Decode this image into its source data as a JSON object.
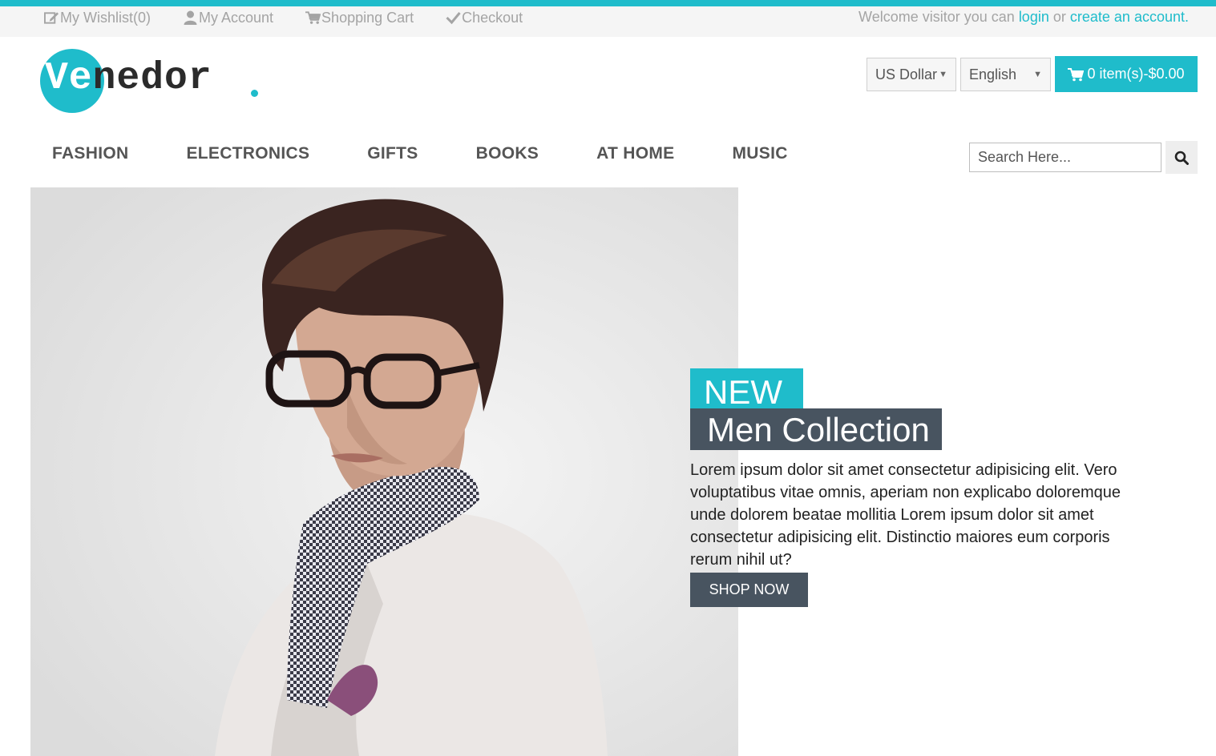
{
  "colors": {
    "accent": "#1fbccb",
    "dark": "#485460",
    "topbar_bg": "#f5f5f5",
    "muted_text": "#a4a4a4"
  },
  "topbar": {
    "links": [
      {
        "label": "My Wishlist(0)",
        "icon": "edit-icon"
      },
      {
        "label": "My Account",
        "icon": "user-icon"
      },
      {
        "label": "Shopping Cart",
        "icon": "cart-icon"
      },
      {
        "label": "Checkout",
        "icon": "check-icon"
      }
    ],
    "welcome_prefix": "Welcome visitor you can",
    "login_label": "login",
    "or_label": "or",
    "create_account_label": "create an account."
  },
  "logo": {
    "part1": "Ve",
    "part2": "nedor"
  },
  "header": {
    "currency": "US Dollar",
    "language": "English",
    "cart_label": "0 item(s)-$0.00"
  },
  "nav": {
    "items": [
      "FASHION",
      "ELECTRONICS",
      "GIFTS",
      "BOOKS",
      "AT HOME",
      "MUSIC"
    ]
  },
  "search": {
    "placeholder": "Search Here..."
  },
  "hero": {
    "badge": "NEW",
    "title": "Men Collection",
    "description": "Lorem ipsum dolor sit amet consectetur adipisicing elit. Vero voluptatibus vitae omnis, aperiam non explicabo doloremque unde dolorem beatae mollitia Lorem ipsum dolor sit amet consectetur adipisicing elit. Distinctio maiores eum corporis rerum nihil ut?",
    "cta": "SHOP NOW"
  }
}
